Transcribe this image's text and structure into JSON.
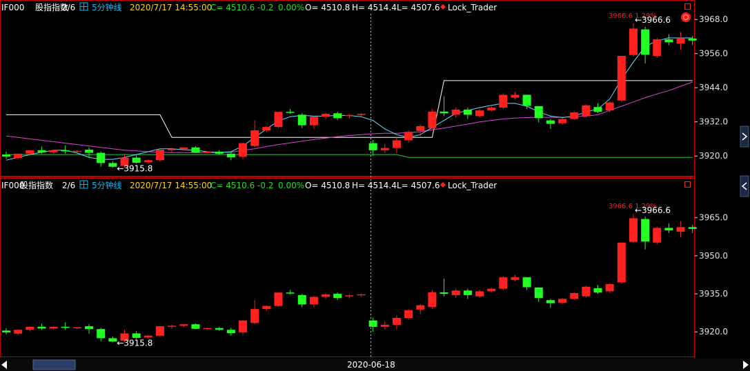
{
  "colors": {
    "background": "#000000",
    "up": "#ff2020",
    "down": "#22ff22",
    "frame": "#c00000",
    "axis_text": "#e0e0e0",
    "header_white": "#ffffff",
    "header_yellow": "#ffd700",
    "header_green": "#22dd22",
    "header_cyan": "#00bfff",
    "step_line": "#ffffff",
    "support_line": "#22cc44",
    "ma_fast": "#66e0ff",
    "ma_slow": "#dd44dd",
    "max_label": "#ff2020",
    "mark_text": "#ffffff"
  },
  "header": {
    "symbol": "IF000",
    "name": "股指指数",
    "index": "2/6",
    "period": "5分钟线",
    "datetime": "2020/7/17 14:55:00",
    "close": "C= 4510.6",
    "change": "-0.2",
    "change_pct": "0.00%",
    "open": "O= 4510.8",
    "high": "H= 4514.4",
    "low": "L= 4507.6",
    "indicator": "Lock_Trader"
  },
  "icons": {
    "chart_icon": "grid-chart-icon",
    "indicator_marker": "red-diamond-icon",
    "panel_close": "square-icon",
    "alert": "red-circle-icon",
    "scroll_left": "left-triangle-icon",
    "side_tabs": "chevron-right-icon"
  },
  "xaxis": {
    "date_label": "2020-06-18"
  },
  "chart_data": [
    {
      "type": "candlestick",
      "panel": "upper",
      "title": "",
      "ylim": [
        3913,
        3970
      ],
      "yticks": [
        "3968.0",
        "3956.0",
        "3944.0",
        "3932.0",
        "3920.0"
      ],
      "ytick_values": [
        3968,
        3956,
        3944,
        3932,
        3920
      ],
      "annotations": {
        "max_label": "3966.6 1.29%",
        "max_mark": "←3966.6",
        "min_mark": "←3915.8"
      },
      "overlays": {
        "step_line": [
          [
            0,
            3934.5
          ],
          [
            13,
            3934.5
          ],
          [
            14,
            3926.5
          ],
          [
            36,
            3926.5
          ],
          [
            37,
            3946.5
          ],
          [
            58,
            3946.5
          ]
        ],
        "support_line": [
          [
            0,
            3920.5
          ],
          [
            33,
            3920.5
          ],
          [
            34,
            3919.5
          ],
          [
            58,
            3919.5
          ]
        ],
        "ma_fast": [
          3918.5,
          3919.5,
          3920.5,
          3921.3,
          3922,
          3922,
          3921,
          3919.5,
          3918.8,
          3918.8,
          3919.5,
          3920.5,
          3921.5,
          3922.5,
          3922.5,
          3922.2,
          3922,
          3921.5,
          3921.2,
          3921.5,
          3923.5,
          3926.5,
          3929.5,
          3932.3,
          3933.8,
          3934.3,
          3934,
          3934,
          3934.3,
          3934.2,
          3933.8,
          3932.5,
          3929.5,
          3927.5,
          3926.5,
          3927.5,
          3930,
          3932.5,
          3935,
          3936,
          3937,
          3937.8,
          3938.5,
          3938.5,
          3937.5,
          3935.5,
          3934,
          3933.5,
          3934,
          3935.5,
          3936.5,
          3940,
          3947,
          3953,
          3958.5,
          3960.5,
          3961.5,
          3961.5,
          3961.5
        ],
        "ma_slow": [
          3927,
          3926.5,
          3926,
          3925.5,
          3925,
          3924.5,
          3924,
          3923.5,
          3923,
          3922.5,
          3922,
          3921.8,
          3921.5,
          3921.3,
          3921.2,
          3921.2,
          3921.2,
          3921.2,
          3921.2,
          3921.3,
          3922,
          3922.5,
          3923.3,
          3924,
          3924.6,
          3925.2,
          3925.8,
          3926.3,
          3926.8,
          3927.2,
          3927.5,
          3927.8,
          3928,
          3928,
          3928.2,
          3928.5,
          3929.2,
          3929.8,
          3930.5,
          3931.2,
          3932,
          3932.5,
          3933,
          3933.3,
          3933.5,
          3933.6,
          3933.6,
          3933.6,
          3933.8,
          3934,
          3934.5,
          3936,
          3937.5,
          3939,
          3940.5,
          3941.8,
          3943,
          3944.5,
          3946
        ]
      }
    },
    {
      "type": "candlestick",
      "panel": "lower",
      "title": "",
      "ylim": [
        3910,
        3972
      ],
      "yticks": [
        "3965.0",
        "3950.0",
        "3935.0",
        "3920.0"
      ],
      "ytick_values": [
        3965,
        3950,
        3935,
        3920
      ],
      "annotations": {
        "max_label": "3966.6 1.29%",
        "max_mark": "←3966.6",
        "min_mark": "←3915.8"
      }
    }
  ],
  "candles": [
    {
      "o": 3920.5,
      "h": 3921.5,
      "c": 3919.8,
      "l": 3919.0
    },
    {
      "o": 3919.3,
      "h": 3920.8,
      "c": 3920.8,
      "l": 3918.8
    },
    {
      "o": 3920.8,
      "h": 3922.0,
      "c": 3922.0,
      "l": 3920.2
    },
    {
      "o": 3922.0,
      "h": 3923.3,
      "c": 3921.3,
      "l": 3920.8
    },
    {
      "o": 3921.3,
      "h": 3922.2,
      "c": 3922.0,
      "l": 3920.8
    },
    {
      "o": 3922.0,
      "h": 3923.8,
      "c": 3921.6,
      "l": 3920.8
    },
    {
      "o": 3921.6,
      "h": 3922.0,
      "c": 3921.8,
      "l": 3921.1
    },
    {
      "o": 3922.2,
      "h": 3923.0,
      "c": 3921.1,
      "l": 3919.3
    },
    {
      "o": 3921.1,
      "h": 3921.6,
      "c": 3917.5,
      "l": 3916.3
    },
    {
      "o": 3917.5,
      "h": 3918.2,
      "c": 3916.2,
      "l": 3915.8
    },
    {
      "o": 3916.5,
      "h": 3920.8,
      "c": 3919.4,
      "l": 3915.8
    },
    {
      "o": 3919.4,
      "h": 3920.3,
      "c": 3917.6,
      "l": 3917.2
    },
    {
      "o": 3917.8,
      "h": 3918.8,
      "c": 3918.5,
      "l": 3917.2
    },
    {
      "o": 3918.5,
      "h": 3922.2,
      "c": 3922.2,
      "l": 3918.0
    },
    {
      "o": 3922.0,
      "h": 3922.8,
      "c": 3922.4,
      "l": 3921.2
    },
    {
      "o": 3922.4,
      "h": 3923.0,
      "c": 3923.0,
      "l": 3921.8
    },
    {
      "o": 3923.0,
      "h": 3923.4,
      "c": 3921.2,
      "l": 3921.0
    },
    {
      "o": 3921.2,
      "h": 3921.6,
      "c": 3921.5,
      "l": 3920.8
    },
    {
      "o": 3921.5,
      "h": 3922.0,
      "c": 3920.8,
      "l": 3920.4
    },
    {
      "o": 3920.8,
      "h": 3921.6,
      "c": 3919.5,
      "l": 3918.5
    },
    {
      "o": 3919.8,
      "h": 3924.5,
      "c": 3924.5,
      "l": 3918.8
    },
    {
      "o": 3923.5,
      "h": 3932.5,
      "c": 3929.0,
      "l": 3923.0
    },
    {
      "o": 3929.0,
      "h": 3930.5,
      "c": 3930.2,
      "l": 3928.2
    },
    {
      "o": 3930.2,
      "h": 3935.5,
      "c": 3935.5,
      "l": 3929.8
    },
    {
      "o": 3935.5,
      "h": 3936.5,
      "c": 3935.3,
      "l": 3934.8
    },
    {
      "o": 3934.5,
      "h": 3935.0,
      "c": 3930.8,
      "l": 3929.8
    },
    {
      "o": 3930.8,
      "h": 3934.0,
      "c": 3933.8,
      "l": 3929.6
    },
    {
      "o": 3933.8,
      "h": 3935.2,
      "c": 3934.8,
      "l": 3933.0
    },
    {
      "o": 3935.0,
      "h": 3935.6,
      "c": 3933.3,
      "l": 3932.6
    },
    {
      "o": 3934.2,
      "h": 3934.8,
      "c": 3934.4,
      "l": 3933.2
    },
    {
      "o": 3934.5,
      "h": 3935.0,
      "c": 3934.8,
      "l": 3933.8
    },
    {
      "o": 3924.5,
      "h": 3925.6,
      "c": 3922.0,
      "l": 3920.0
    },
    {
      "o": 3922.0,
      "h": 3924.2,
      "c": 3922.8,
      "l": 3921.0
    },
    {
      "o": 3922.8,
      "h": 3926.5,
      "c": 3925.5,
      "l": 3921.0
    },
    {
      "o": 3925.5,
      "h": 3929.0,
      "c": 3928.5,
      "l": 3924.8
    },
    {
      "o": 3928.8,
      "h": 3931.0,
      "c": 3930.5,
      "l": 3927.0
    },
    {
      "o": 3929.8,
      "h": 3936.5,
      "c": 3935.6,
      "l": 3929.0
    },
    {
      "o": 3935.6,
      "h": 3941.0,
      "c": 3935.0,
      "l": 3934.0
    },
    {
      "o": 3934.5,
      "h": 3937.0,
      "c": 3936.3,
      "l": 3933.5
    },
    {
      "o": 3936.3,
      "h": 3937.0,
      "c": 3934.5,
      "l": 3933.0
    },
    {
      "o": 3934.0,
      "h": 3936.5,
      "c": 3936.0,
      "l": 3933.5
    },
    {
      "o": 3936.0,
      "h": 3937.5,
      "c": 3937.0,
      "l": 3935.6
    },
    {
      "o": 3937.0,
      "h": 3942.0,
      "c": 3941.5,
      "l": 3936.5
    },
    {
      "o": 3940.5,
      "h": 3942.5,
      "c": 3941.5,
      "l": 3940.0
    },
    {
      "o": 3941.5,
      "h": 3941.6,
      "c": 3937.6,
      "l": 3936.5
    },
    {
      "o": 3937.5,
      "h": 3937.6,
      "c": 3933.3,
      "l": 3931.8
    },
    {
      "o": 3932.5,
      "h": 3933.0,
      "c": 3931.3,
      "l": 3929.5
    },
    {
      "o": 3931.5,
      "h": 3933.3,
      "c": 3933.0,
      "l": 3931.0
    },
    {
      "o": 3933.0,
      "h": 3935.6,
      "c": 3935.3,
      "l": 3932.6
    },
    {
      "o": 3934.0,
      "h": 3938.2,
      "c": 3937.8,
      "l": 3933.5
    },
    {
      "o": 3937.2,
      "h": 3938.5,
      "c": 3935.5,
      "l": 3935.0
    },
    {
      "o": 3936.0,
      "h": 3939.2,
      "c": 3938.8,
      "l": 3935.3
    },
    {
      "o": 3939.5,
      "h": 3955.2,
      "c": 3955.2,
      "l": 3939.0
    },
    {
      "o": 3955.5,
      "h": 3966.6,
      "c": 3964.8,
      "l": 3955.0
    },
    {
      "o": 3964.5,
      "h": 3965.5,
      "c": 3955.6,
      "l": 3952.5
    },
    {
      "o": 3955.2,
      "h": 3961.5,
      "c": 3961.0,
      "l": 3954.5
    },
    {
      "o": 3961.0,
      "h": 3962.8,
      "c": 3960.0,
      "l": 3959.0
    },
    {
      "o": 3959.5,
      "h": 3963.6,
      "c": 3961.3,
      "l": 3957.3
    },
    {
      "o": 3961.3,
      "h": 3962.2,
      "c": 3960.6,
      "l": 3959.0
    }
  ]
}
